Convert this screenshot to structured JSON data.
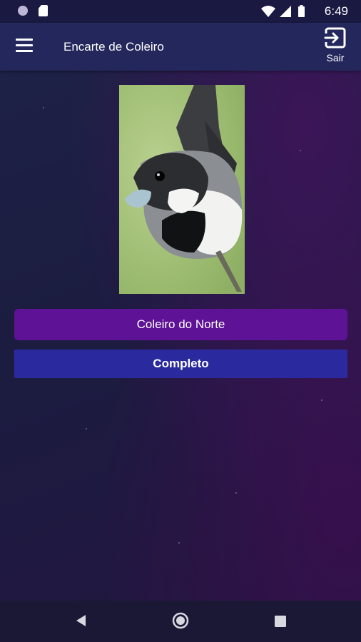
{
  "status_bar": {
    "time": "6:49",
    "icons": [
      "circle-indicator-icon",
      "sd-card-icon",
      "wifi-icon",
      "signal-icon",
      "battery-icon"
    ]
  },
  "app_bar": {
    "title": "Encarte de Coleiro",
    "exit_label": "Sair"
  },
  "main": {
    "image_alt": "bird-photo",
    "name_button_label": "Coleiro do Norte",
    "status_button_label": "Completo"
  },
  "colors": {
    "app_bar": "#23275b",
    "name_button": "#5e1295",
    "status_button": "#2a2a9e"
  }
}
